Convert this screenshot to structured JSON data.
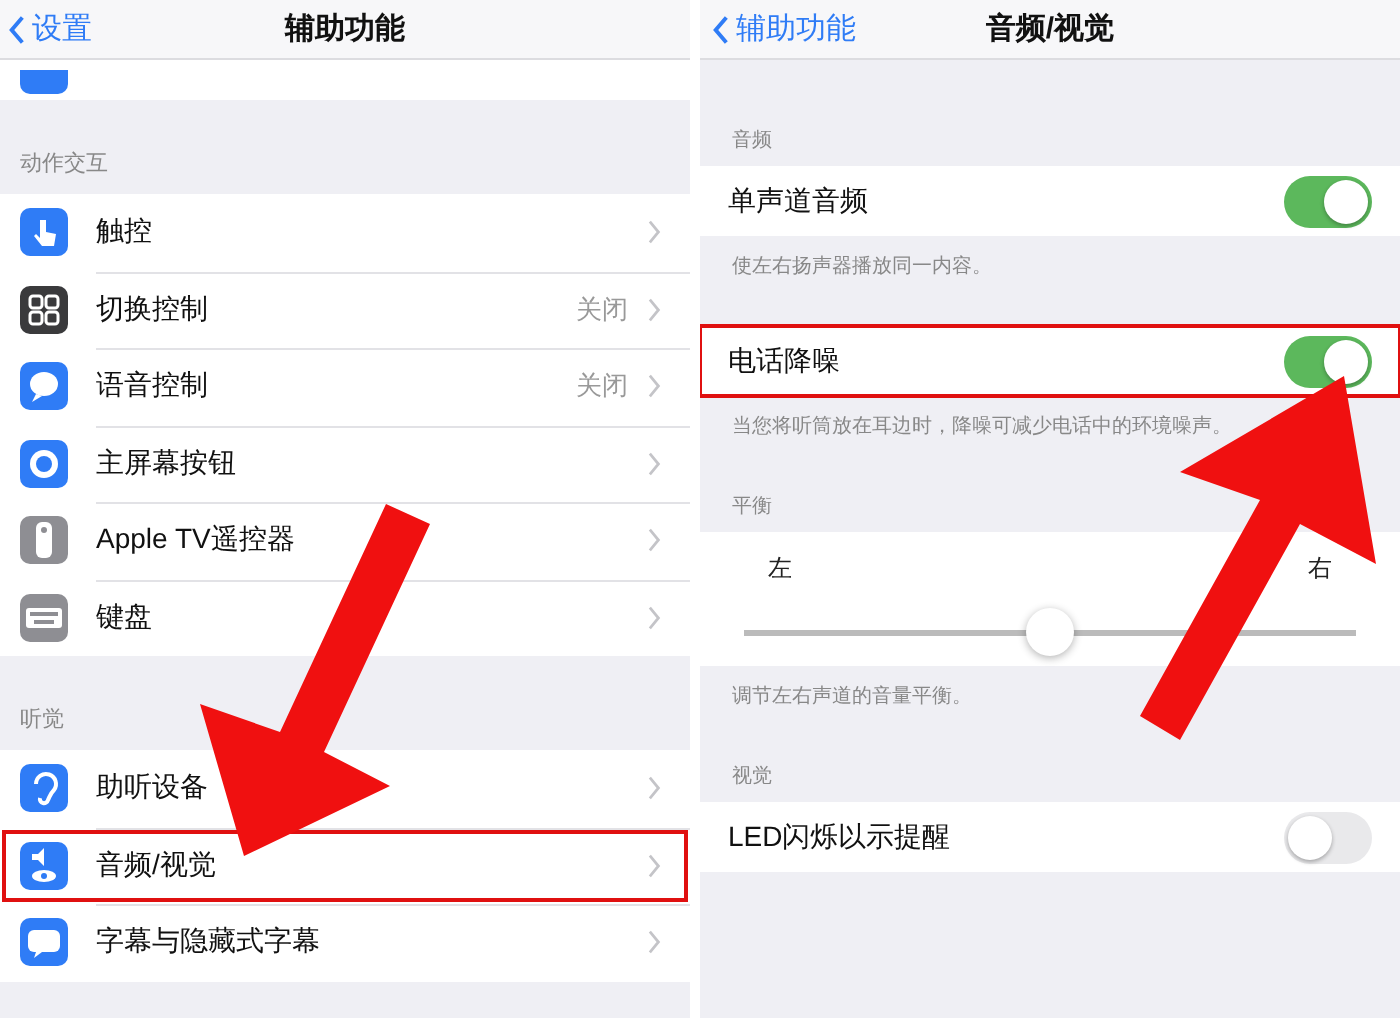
{
  "left": {
    "nav": {
      "back": "设置",
      "title": "辅助功能"
    },
    "sections": [
      {
        "header": "动作交互",
        "rows": [
          {
            "label": "触控",
            "highlighted": false
          },
          {
            "label": "切换控制",
            "value": "关闭",
            "highlighted": false
          },
          {
            "label": "语音控制",
            "value": "关闭",
            "highlighted": false
          },
          {
            "label": "主屏幕按钮",
            "highlighted": false
          },
          {
            "label": "Apple TV遥控器",
            "highlighted": false
          },
          {
            "label": "键盘",
            "highlighted": false
          }
        ]
      },
      {
        "header": "听觉",
        "rows": [
          {
            "label": "助听设备",
            "highlighted": false
          },
          {
            "label": "音频/视觉",
            "highlighted": true
          },
          {
            "label": "字幕与隐藏式字幕",
            "highlighted": false
          }
        ]
      }
    ]
  },
  "right": {
    "nav": {
      "back": "辅助功能",
      "title": "音频/视觉"
    },
    "groups": [
      {
        "header": "音频",
        "rows": [
          {
            "kind": "toggle",
            "label": "单声道音频",
            "on": true,
            "highlighted": false
          }
        ],
        "footer": "使左右扬声器播放同一内容。"
      },
      {
        "rows": [
          {
            "kind": "toggle",
            "label": "电话降噪",
            "on": true,
            "highlighted": true
          }
        ],
        "footer": "当您将听筒放在耳边时，降噪可减少电话中的环境噪声。"
      },
      {
        "header": "平衡",
        "rows": [
          {
            "kind": "slider",
            "left": "左",
            "right": "右",
            "level": 0.5
          }
        ],
        "footer": "调节左右声道的音量平衡。"
      },
      {
        "header": "视觉",
        "rows": [
          {
            "kind": "toggle",
            "label": "LED闪烁以示提醒",
            "on": false,
            "highlighted": false
          }
        ]
      }
    ]
  }
}
